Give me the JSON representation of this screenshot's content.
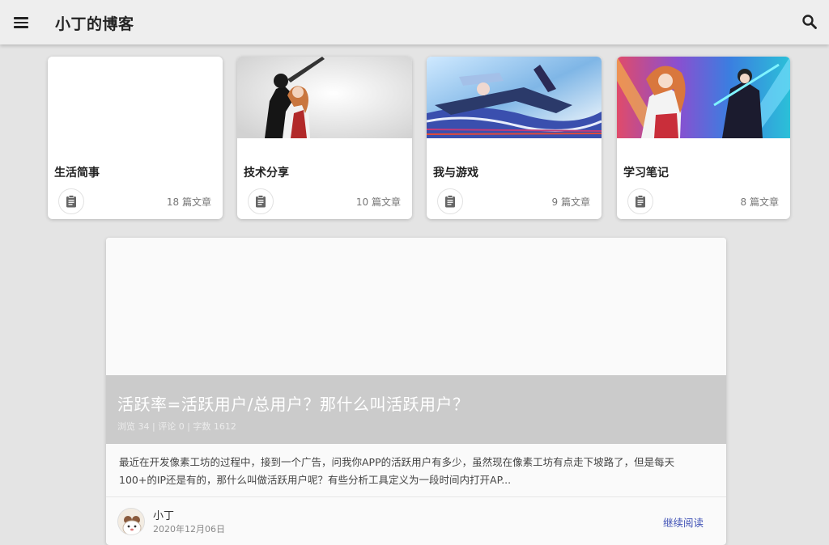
{
  "appbar": {
    "title": "小丁的博客",
    "menu_icon": "menu-icon",
    "search_icon": "search-icon"
  },
  "categories": [
    {
      "name": "生活简事",
      "count": "18 篇文章",
      "icon": "clipboard-icon"
    },
    {
      "name": "技术分享",
      "count": "10 篇文章",
      "icon": "clipboard-icon"
    },
    {
      "name": "我与游戏",
      "count": "9 篇文章",
      "icon": "clipboard-icon"
    },
    {
      "name": "学习笔记",
      "count": "8 篇文章",
      "icon": "clipboard-icon"
    }
  ],
  "post": {
    "title": "活跃率=活跃用户/总用户？那什么叫活跃用户？",
    "meta": "浏览 34 | 评论 0 | 字数 1612",
    "excerpt": "最近在开发像素工坊的过程中，接到一个广告，问我你APP的活跃用户有多少，虽然现在像素工坊有点走下坡路了，但是每天100+的IP还是有的，那什么叫做活跃用户呢？有些分析工具定义为一段时间内打开AP...",
    "author": "小丁",
    "date": "2020年12月06日",
    "read_more": "继续阅读"
  },
  "colors": {
    "appbar_bg": "#eeeeee",
    "page_bg": "#e4e4e4",
    "accent_link": "#3f51b5",
    "post_header_bg": "#cbcbcb"
  }
}
